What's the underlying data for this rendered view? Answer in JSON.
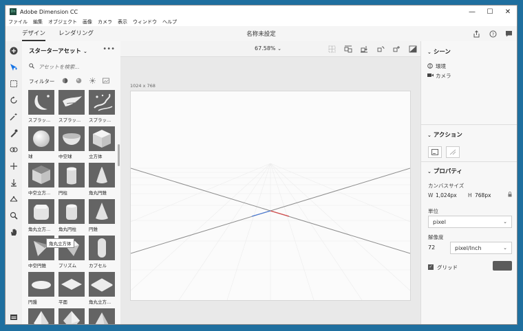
{
  "window": {
    "title": "Adobe Dimension CC",
    "controls": {
      "minimize": "—",
      "maximize": "☐",
      "close": "✕"
    }
  },
  "menu": [
    "ファイル",
    "編集",
    "オブジェクト",
    "画像",
    "カメラ",
    "表示",
    "ウィンドウ",
    "ヘルプ"
  ],
  "topbar": {
    "tabs": [
      {
        "label": "デザイン",
        "active": true
      },
      {
        "label": "レンダリング",
        "active": false
      }
    ],
    "doc_title": "名称未設定",
    "icons": [
      "share-icon",
      "help-icon",
      "feedback-icon"
    ]
  },
  "tools": [
    "add-icon",
    "select-icon",
    "marquee-icon",
    "orbit-icon",
    "magic-wand-icon",
    "sampler-icon",
    "link-icon",
    "pan-icon",
    "drop-icon",
    "horizon-icon",
    "zoom-icon",
    "hand-icon",
    "panel-icon"
  ],
  "assets": {
    "title": "スターターアセット",
    "more": "•••",
    "search_placeholder": "アセットを検索...",
    "filter_label": "フィルター",
    "filter_icons": [
      "model-filter-icon",
      "material-filter-icon",
      "light-filter-icon",
      "image-filter-icon"
    ],
    "items": [
      {
        "label": "スプラッ..."
      },
      {
        "label": "スプラッ..."
      },
      {
        "label": "スプラッ..."
      },
      {
        "label": "球"
      },
      {
        "label": "中空球"
      },
      {
        "label": "立方体"
      },
      {
        "label": "中空立方..."
      },
      {
        "label": "円柱"
      },
      {
        "label": "角丸円錐"
      },
      {
        "label": "角丸立方..."
      },
      {
        "label": "角丸円柱"
      },
      {
        "label": "円錐"
      },
      {
        "label": "中空円錐"
      },
      {
        "label": "プリズム"
      },
      {
        "label": "カプセル"
      },
      {
        "label": "円盤"
      },
      {
        "label": "平面"
      },
      {
        "label": "角丸立方..."
      },
      {
        "label": ""
      },
      {
        "label": ""
      },
      {
        "label": ""
      }
    ],
    "tooltip": "角丸立方体"
  },
  "canvas": {
    "zoom": "67.58%",
    "size_label": "1024 x 768"
  },
  "scene": {
    "title": "シーン",
    "items": [
      {
        "label": "環境",
        "icon": "environment-icon"
      },
      {
        "label": "カメラ",
        "icon": "camera-icon"
      }
    ]
  },
  "actions": {
    "title": "アクション"
  },
  "properties": {
    "title": "プロパティ",
    "canvas_size_label": "カンバスサイズ",
    "w_label": "W",
    "w_value": "1,024px",
    "h_label": "H",
    "h_value": "768px",
    "unit_label": "単位",
    "unit_value": "pixel",
    "resolution_label": "解像度",
    "resolution_value": "72",
    "resolution_unit": "pixel/Inch",
    "grid_label": "グリッド",
    "grid_checked": true,
    "grid_color": "#5b5b5b"
  }
}
